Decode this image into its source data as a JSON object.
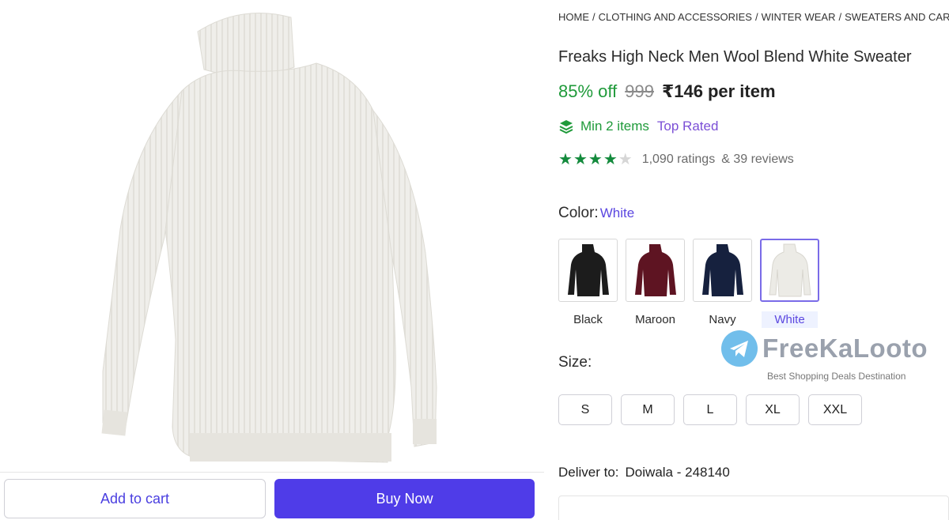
{
  "breadcrumb": {
    "items": [
      "HOME",
      "CLOTHING AND ACCESSORIES",
      "WINTER WEAR",
      "SWEATERS AND CARDIGANS"
    ],
    "separator": "/"
  },
  "product": {
    "title": "Freaks High Neck Men Wool Blend White Sweater",
    "discount": "85% off",
    "mrp": "999",
    "price": "₹146",
    "price_unit": "per item",
    "min_items": "Min 2 items",
    "top_rated": "Top Rated",
    "rating_stars": 4,
    "rating_max": 5,
    "ratings_count": "1,090 ratings",
    "reviews_count": "& 39 reviews"
  },
  "color": {
    "label": "Color:",
    "selected": "White",
    "options": [
      {
        "name": "Black",
        "hex": "#1c1c1c"
      },
      {
        "name": "Maroon",
        "hex": "#5e1422"
      },
      {
        "name": "Navy",
        "hex": "#16213e"
      },
      {
        "name": "White",
        "hex": "#ecebe6"
      }
    ]
  },
  "size": {
    "label": "Size:",
    "options": [
      "S",
      "M",
      "L",
      "XL",
      "XXL"
    ]
  },
  "delivery": {
    "label": "Deliver to:",
    "location": "Doiwala - 248140"
  },
  "actions": {
    "add_to_cart": "Add to cart",
    "buy_now": "Buy Now"
  },
  "watermark": {
    "brand": "FreeKaLooto",
    "tagline": "Best Shopping Deals Destination"
  },
  "colors": {
    "accent": "#4f3ce8",
    "green": "#1f9a3a",
    "purple": "#7b4fd6"
  },
  "icons": {
    "min_items": "layers-icon",
    "watermark_logo": "telegram-icon"
  }
}
